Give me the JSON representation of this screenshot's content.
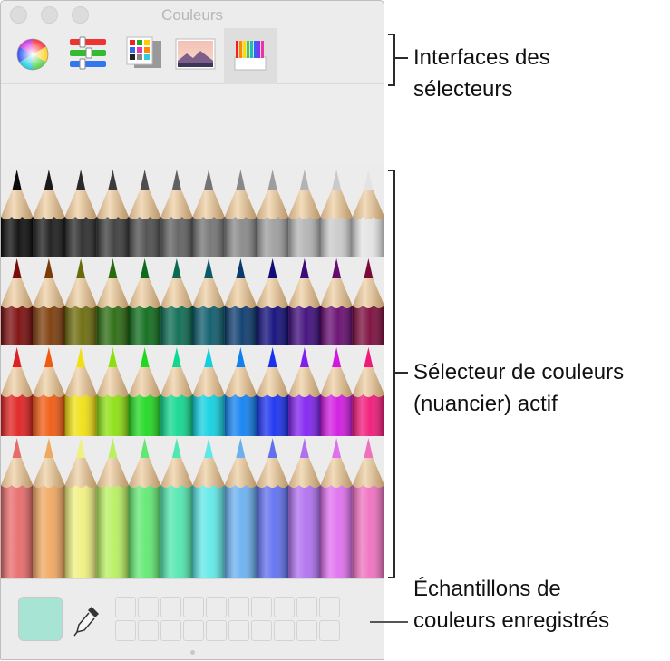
{
  "window": {
    "title": "Couleurs"
  },
  "toolbar": {
    "buttons": [
      {
        "name": "color-wheel",
        "active": false
      },
      {
        "name": "color-sliders",
        "active": false
      },
      {
        "name": "color-palettes",
        "active": false
      },
      {
        "name": "image-palettes",
        "active": false
      },
      {
        "name": "pencils",
        "active": true
      }
    ]
  },
  "pencils": {
    "rows": [
      [
        "#0b0b0b",
        "#1a1a1a",
        "#2a2a2a",
        "#3b3b3b",
        "#4d4d4d",
        "#606060",
        "#737373",
        "#888888",
        "#9d9d9d",
        "#b3b3b3",
        "#cacaca",
        "#e3e3e3"
      ],
      [
        "#7a0b0b",
        "#7b3b08",
        "#6b6a0a",
        "#2a6a0e",
        "#0d6b1a",
        "#0b6b52",
        "#0a5a6a",
        "#0a3a6e",
        "#100c7a",
        "#3e0a7a",
        "#650a6f",
        "#7a0a3a"
      ],
      [
        "#e02020",
        "#f05a10",
        "#f0e010",
        "#8ce010",
        "#20d820",
        "#10d890",
        "#10d0e0",
        "#1080f0",
        "#1830f0",
        "#8020f0",
        "#d018e0",
        "#f01878"
      ],
      [
        "#e86a6a",
        "#f0a860",
        "#f0f080",
        "#b8f060",
        "#60e870",
        "#50e8b0",
        "#60e8e8",
        "#6ab0f0",
        "#6070f0",
        "#b070f0",
        "#e070f0",
        "#f070c0"
      ]
    ]
  },
  "callouts": {
    "interfaces": [
      "Interfaces des",
      "sélecteurs"
    ],
    "active": [
      "Sélecteur de couleurs",
      "(nuancier) actif"
    ],
    "swatches": [
      "Échantillons de",
      "couleurs enregistrés"
    ]
  },
  "current_color": "#a7e4d4"
}
